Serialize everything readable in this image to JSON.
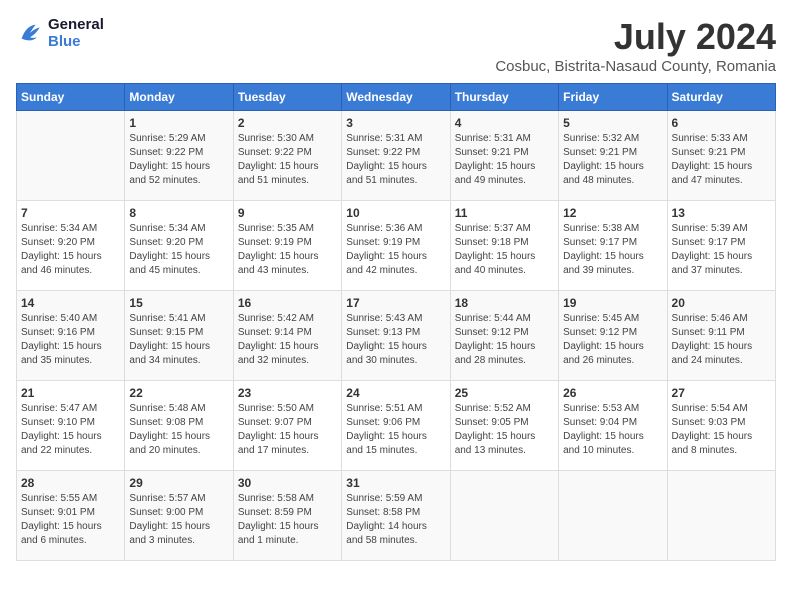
{
  "logo": {
    "line1": "General",
    "line2": "Blue"
  },
  "title": "July 2024",
  "subtitle": "Cosbuc, Bistrita-Nasaud County, Romania",
  "days_header": [
    "Sunday",
    "Monday",
    "Tuesday",
    "Wednesday",
    "Thursday",
    "Friday",
    "Saturday"
  ],
  "weeks": [
    [
      {
        "day": "",
        "info": ""
      },
      {
        "day": "1",
        "info": "Sunrise: 5:29 AM\nSunset: 9:22 PM\nDaylight: 15 hours\nand 52 minutes."
      },
      {
        "day": "2",
        "info": "Sunrise: 5:30 AM\nSunset: 9:22 PM\nDaylight: 15 hours\nand 51 minutes."
      },
      {
        "day": "3",
        "info": "Sunrise: 5:31 AM\nSunset: 9:22 PM\nDaylight: 15 hours\nand 51 minutes."
      },
      {
        "day": "4",
        "info": "Sunrise: 5:31 AM\nSunset: 9:21 PM\nDaylight: 15 hours\nand 49 minutes."
      },
      {
        "day": "5",
        "info": "Sunrise: 5:32 AM\nSunset: 9:21 PM\nDaylight: 15 hours\nand 48 minutes."
      },
      {
        "day": "6",
        "info": "Sunrise: 5:33 AM\nSunset: 9:21 PM\nDaylight: 15 hours\nand 47 minutes."
      }
    ],
    [
      {
        "day": "7",
        "info": "Sunrise: 5:34 AM\nSunset: 9:20 PM\nDaylight: 15 hours\nand 46 minutes."
      },
      {
        "day": "8",
        "info": "Sunrise: 5:34 AM\nSunset: 9:20 PM\nDaylight: 15 hours\nand 45 minutes."
      },
      {
        "day": "9",
        "info": "Sunrise: 5:35 AM\nSunset: 9:19 PM\nDaylight: 15 hours\nand 43 minutes."
      },
      {
        "day": "10",
        "info": "Sunrise: 5:36 AM\nSunset: 9:19 PM\nDaylight: 15 hours\nand 42 minutes."
      },
      {
        "day": "11",
        "info": "Sunrise: 5:37 AM\nSunset: 9:18 PM\nDaylight: 15 hours\nand 40 minutes."
      },
      {
        "day": "12",
        "info": "Sunrise: 5:38 AM\nSunset: 9:17 PM\nDaylight: 15 hours\nand 39 minutes."
      },
      {
        "day": "13",
        "info": "Sunrise: 5:39 AM\nSunset: 9:17 PM\nDaylight: 15 hours\nand 37 minutes."
      }
    ],
    [
      {
        "day": "14",
        "info": "Sunrise: 5:40 AM\nSunset: 9:16 PM\nDaylight: 15 hours\nand 35 minutes."
      },
      {
        "day": "15",
        "info": "Sunrise: 5:41 AM\nSunset: 9:15 PM\nDaylight: 15 hours\nand 34 minutes."
      },
      {
        "day": "16",
        "info": "Sunrise: 5:42 AM\nSunset: 9:14 PM\nDaylight: 15 hours\nand 32 minutes."
      },
      {
        "day": "17",
        "info": "Sunrise: 5:43 AM\nSunset: 9:13 PM\nDaylight: 15 hours\nand 30 minutes."
      },
      {
        "day": "18",
        "info": "Sunrise: 5:44 AM\nSunset: 9:12 PM\nDaylight: 15 hours\nand 28 minutes."
      },
      {
        "day": "19",
        "info": "Sunrise: 5:45 AM\nSunset: 9:12 PM\nDaylight: 15 hours\nand 26 minutes."
      },
      {
        "day": "20",
        "info": "Sunrise: 5:46 AM\nSunset: 9:11 PM\nDaylight: 15 hours\nand 24 minutes."
      }
    ],
    [
      {
        "day": "21",
        "info": "Sunrise: 5:47 AM\nSunset: 9:10 PM\nDaylight: 15 hours\nand 22 minutes."
      },
      {
        "day": "22",
        "info": "Sunrise: 5:48 AM\nSunset: 9:08 PM\nDaylight: 15 hours\nand 20 minutes."
      },
      {
        "day": "23",
        "info": "Sunrise: 5:50 AM\nSunset: 9:07 PM\nDaylight: 15 hours\nand 17 minutes."
      },
      {
        "day": "24",
        "info": "Sunrise: 5:51 AM\nSunset: 9:06 PM\nDaylight: 15 hours\nand 15 minutes."
      },
      {
        "day": "25",
        "info": "Sunrise: 5:52 AM\nSunset: 9:05 PM\nDaylight: 15 hours\nand 13 minutes."
      },
      {
        "day": "26",
        "info": "Sunrise: 5:53 AM\nSunset: 9:04 PM\nDaylight: 15 hours\nand 10 minutes."
      },
      {
        "day": "27",
        "info": "Sunrise: 5:54 AM\nSunset: 9:03 PM\nDaylight: 15 hours\nand 8 minutes."
      }
    ],
    [
      {
        "day": "28",
        "info": "Sunrise: 5:55 AM\nSunset: 9:01 PM\nDaylight: 15 hours\nand 6 minutes."
      },
      {
        "day": "29",
        "info": "Sunrise: 5:57 AM\nSunset: 9:00 PM\nDaylight: 15 hours\nand 3 minutes."
      },
      {
        "day": "30",
        "info": "Sunrise: 5:58 AM\nSunset: 8:59 PM\nDaylight: 15 hours\nand 1 minute."
      },
      {
        "day": "31",
        "info": "Sunrise: 5:59 AM\nSunset: 8:58 PM\nDaylight: 14 hours\nand 58 minutes."
      },
      {
        "day": "",
        "info": ""
      },
      {
        "day": "",
        "info": ""
      },
      {
        "day": "",
        "info": ""
      }
    ]
  ]
}
